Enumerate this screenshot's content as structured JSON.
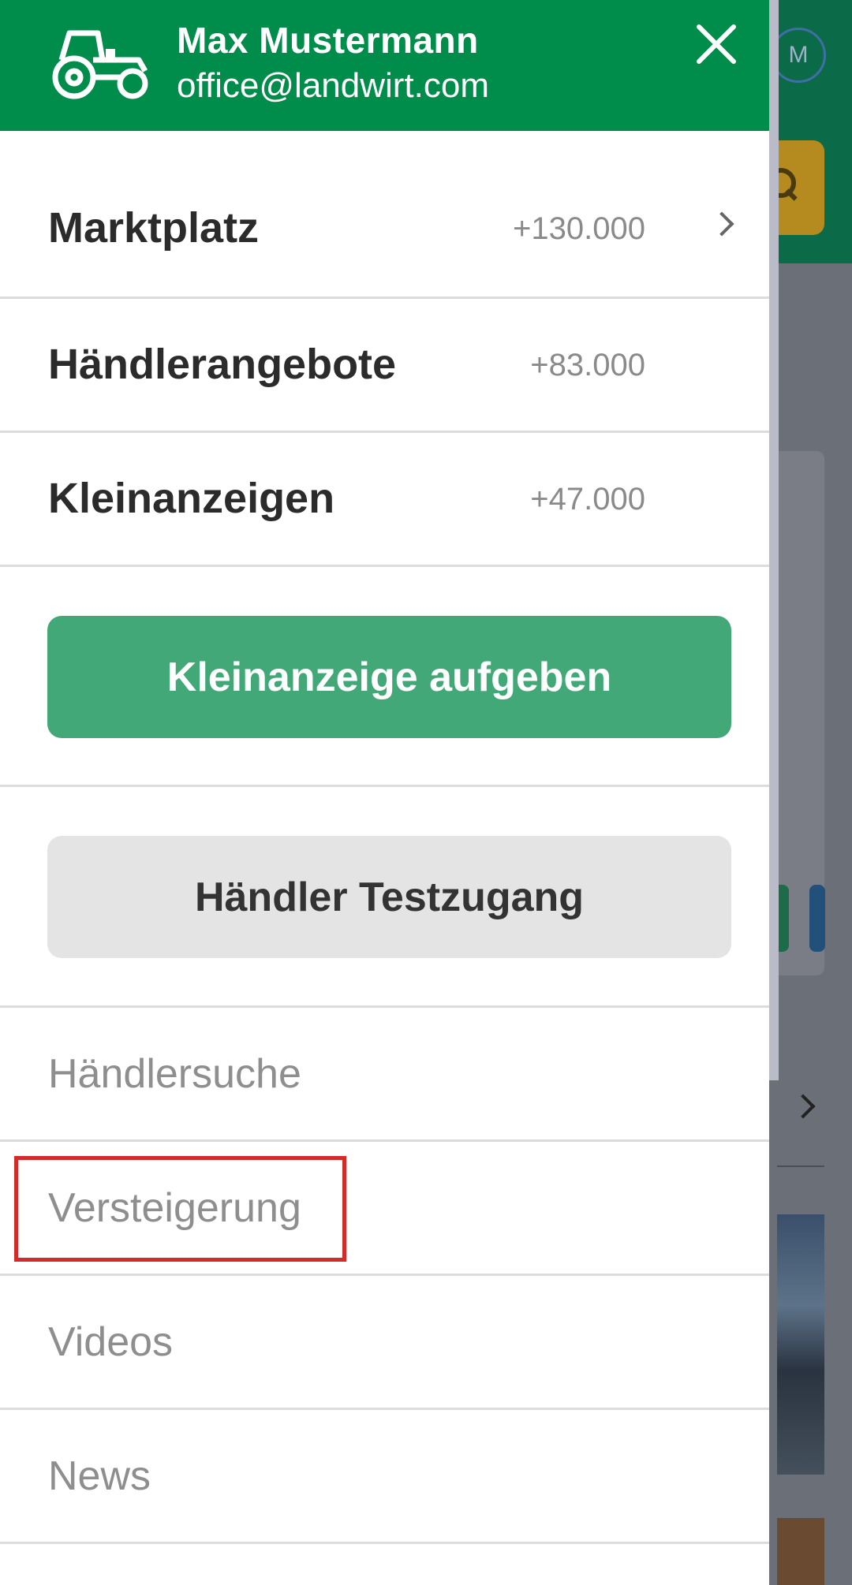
{
  "background": {
    "avatar_initial": "M"
  },
  "drawer": {
    "user": {
      "name": "Max Mustermann",
      "email": "office@landwirt.com"
    },
    "categories": [
      {
        "label": "Marktplatz",
        "count": "+130.000",
        "has_chevron": true
      },
      {
        "label": "Händlerangebote",
        "count": "+83.000",
        "has_chevron": false
      },
      {
        "label": "Kleinanzeigen",
        "count": "+47.000",
        "has_chevron": false
      }
    ],
    "primary_button": "Kleinanzeige aufgeben",
    "secondary_button": "Händler Testzugang",
    "links": [
      {
        "label": "Händlersuche"
      },
      {
        "label": "Versteigerung",
        "highlighted": true
      },
      {
        "label": "Videos"
      },
      {
        "label": "News"
      }
    ],
    "colors": {
      "header_green": "#008c4a",
      "button_green": "#43a878",
      "highlight_red": "#d42a2a"
    }
  }
}
